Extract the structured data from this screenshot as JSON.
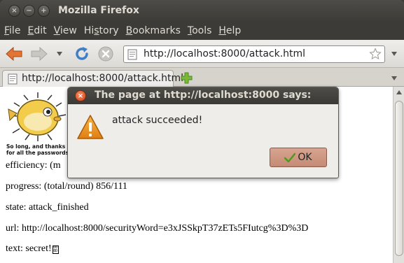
{
  "window": {
    "title": "Mozilla Firefox",
    "controls": {
      "close": "×",
      "minimize": "−",
      "maximize": "+"
    }
  },
  "menubar": {
    "items": [
      {
        "accel": "F",
        "rest": "ile"
      },
      {
        "accel": "E",
        "rest": "dit"
      },
      {
        "accel": "V",
        "rest": "iew"
      },
      {
        "pre": "Hi",
        "accel": "s",
        "rest": "tory"
      },
      {
        "accel": "B",
        "rest": "ookmarks"
      },
      {
        "accel": "T",
        "rest": "ools"
      },
      {
        "accel": "H",
        "rest": "elp"
      }
    ]
  },
  "navbar": {
    "url": "http://localhost:8000/attack.html",
    "icons": [
      "back-arrow-icon",
      "forward-arrow-icon",
      "dropdown-icon",
      "reload-icon",
      "stop-icon",
      "site-identity-icon",
      "bookmark-star-icon"
    ]
  },
  "tabs": [
    {
      "title": "http://localhost:8000/attack.html",
      "active": true
    }
  ],
  "content": {
    "logo_caption_1": "So long, and thanks",
    "logo_caption_2": "for all the passwords",
    "efficiency": "efficiency: (m",
    "progress": "progress: (total/round) 856/111",
    "state": "state: attack_finished",
    "url_line": "url: http://localhost:8000/securityWord=e3xJSSkpT37zETs5FIutcg%3D%3D",
    "text_line": "text: secret!"
  },
  "dialog": {
    "title": "The page at http://localhost:8000 says:",
    "message": "attack succeeded!",
    "ok_label": "OK"
  },
  "colors": {
    "titlebar": "#3c3b37",
    "dialog_close": "#e05a2b",
    "ok_button": "#cf9a84",
    "warning": "#e8941a"
  }
}
